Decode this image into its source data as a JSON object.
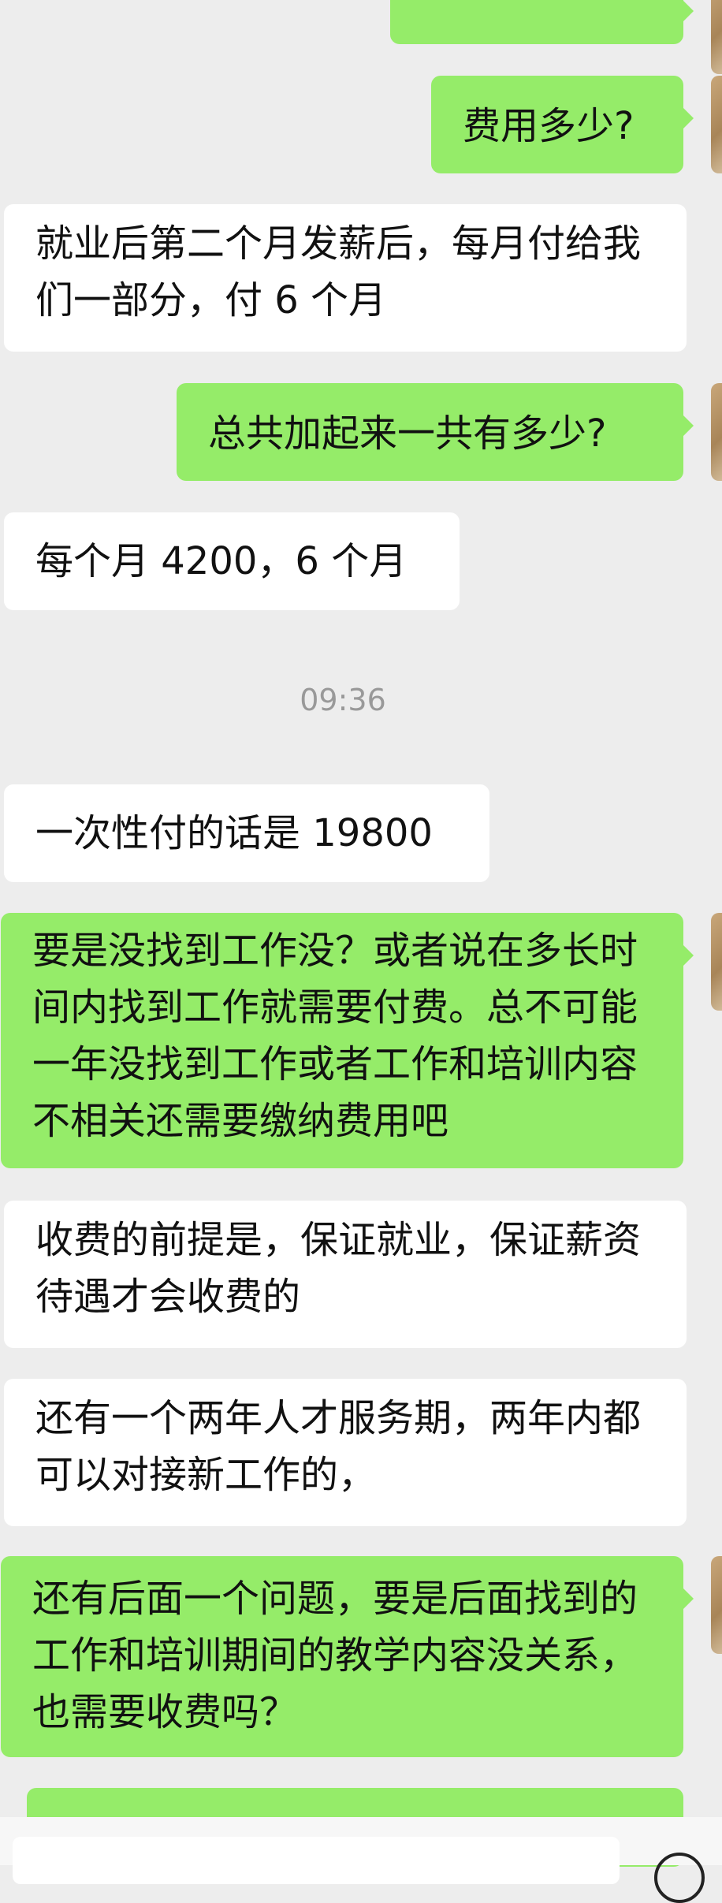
{
  "chat": {
    "messages": [
      {
        "side": "out",
        "text": "费用多少?"
      },
      {
        "side": "in",
        "text": "就业后第二个月发薪后，每月付给我们一部分，付 6 个月"
      },
      {
        "side": "out",
        "text": "总共加起来一共有多少?"
      },
      {
        "side": "in",
        "text": "每个月 4200，6 个月"
      },
      {
        "side": "in",
        "text": "一次性付的话是 19800"
      },
      {
        "side": "out",
        "text": "要是没找到工作没？或者说在多长时间内找到工作就需要付费。总不可能一年没找到工作或者工作和培训内容不相关还需要缴纳费用吧"
      },
      {
        "side": "in",
        "text": "收费的前提是，保证就业，保证薪资待遇才会收费的"
      },
      {
        "side": "in",
        "text": "还有一个两年人才服务期，两年内都可以对接新工作的，"
      },
      {
        "side": "out",
        "text": "还有后面一个问题，要是后面找到的工作和培训期间的教学内容没关系，也需要收费吗？"
      }
    ],
    "timestamp": "09:36"
  },
  "colors": {
    "background": "#ededed",
    "incoming_bubble": "#ffffff",
    "outgoing_bubble": "#95ec69"
  }
}
